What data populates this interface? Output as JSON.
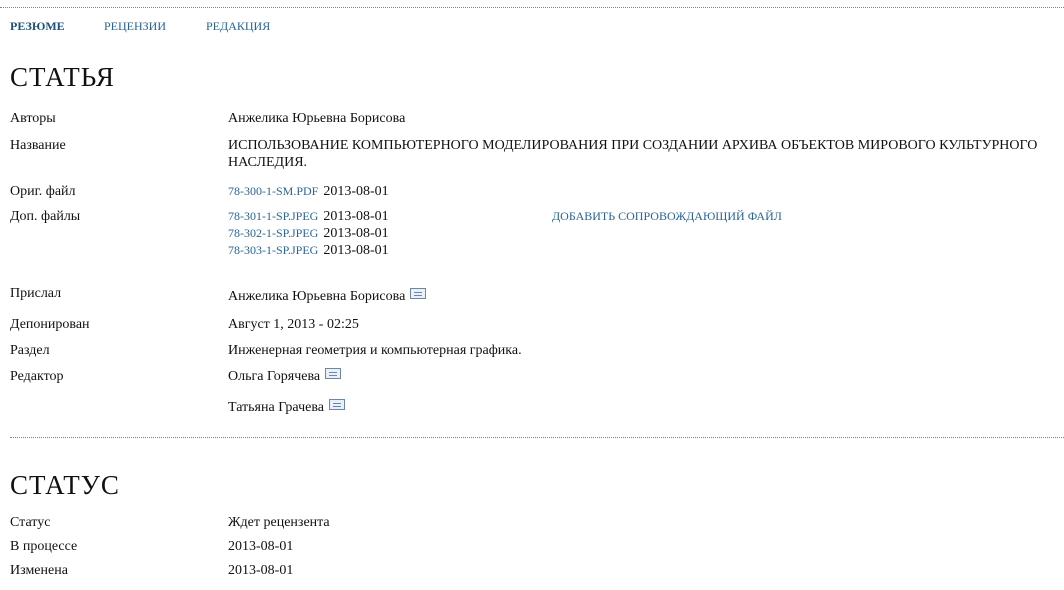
{
  "tabs": [
    {
      "label": "РЕЗЮМЕ",
      "active": true
    },
    {
      "label": "РЕЦЕНЗИИ",
      "active": false
    },
    {
      "label": "РЕДАКЦИЯ",
      "active": false
    }
  ],
  "article": {
    "heading": "СТАТЬЯ",
    "authors_label": "Авторы",
    "authors_value": "Анжелика Юрьевна Борисова",
    "title_label": "Название",
    "title_value": "ИСПОЛЬЗОВАНИЕ КОМПЬЮТЕРНОГО МОДЕЛИРОВАНИЯ ПРИ СОЗДАНИИ АРХИВА ОБЪЕКТОВ МИРОВОГО КУЛЬТУРНОГО НАСЛЕДИЯ.",
    "orig_file_label": "Ориг. файл",
    "orig_file": {
      "name": "78-300-1-SM.PDF",
      "date": "2013-08-01"
    },
    "supp_files_label": "Доп. файлы",
    "supp_files": [
      {
        "name": "78-301-1-SP.JPEG",
        "date": "2013-08-01"
      },
      {
        "name": "78-302-1-SP.JPEG",
        "date": "2013-08-01"
      },
      {
        "name": "78-303-1-SP.JPEG",
        "date": "2013-08-01"
      }
    ],
    "add_supp_file_link": "ДОБАВИТЬ СОПРОВОЖДАЮЩИЙ ФАЙЛ",
    "submitter_label": "Прислал",
    "submitter_value": "Анжелика Юрьевна Борисова",
    "submitted_label": "Депонирован",
    "submitted_value": "Август 1, 2013 - 02:25",
    "section_label": "Раздел",
    "section_value": "Инженерная геометрия и компьютерная графика.",
    "editor_label": "Редактор",
    "editors": [
      "Ольга Горячева",
      "Татьяна Грачева"
    ]
  },
  "status": {
    "heading": "СТАТУС",
    "status_label": "Статус",
    "status_value": "Ждет рецензента",
    "in_progress_label": "В процессе",
    "in_progress_value": "2013-08-01",
    "modified_label": "Изменена",
    "modified_value": "2013-08-01"
  },
  "icons": {
    "email": "envelope-icon"
  },
  "colors": {
    "link": "#2a6496",
    "rule": "#5b8db5"
  }
}
